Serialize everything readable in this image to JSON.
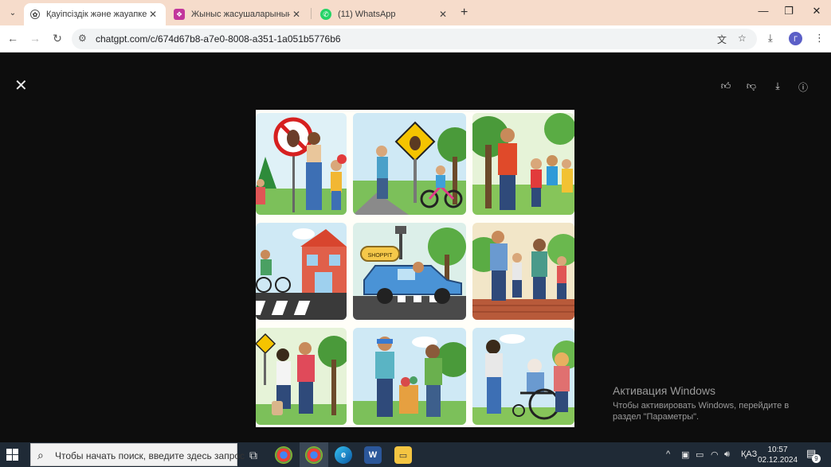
{
  "browser": {
    "tabs": [
      {
        "title": "Қауіпсіздік және жауапкершіл...",
        "active": true,
        "favicon": "chatgpt-icon"
      },
      {
        "title": "Жыныс жасушаларының қалы...",
        "active": false,
        "favicon": "app-icon"
      },
      {
        "title": "(11) WhatsApp",
        "active": false,
        "favicon": "whatsapp-icon"
      }
    ],
    "url": "chatgpt.com/c/674d67b8-a7e0-8008-a351-1a051b5776b6",
    "profile_initial": "Г"
  },
  "viewer": {
    "image_description_panels": 9
  },
  "activation": {
    "title": "Активация Windows",
    "text": "Чтобы активировать Windows, перейдите в раздел \"Параметры\"."
  },
  "image_text": {
    "sign": "SHOPPIT"
  },
  "taskbar": {
    "search_placeholder": "Чтобы начать поиск, введите здесь запрос",
    "language": "ҚАЗ",
    "time": "10:57",
    "date": "02.12.2024",
    "notifications": "9"
  },
  "colors": {
    "tabstrip": "#f6dccb",
    "viewer_bg": "#0d0d0d",
    "taskbar": "#1f2a36",
    "whatsapp": "#25d366",
    "app_magenta": "#c2369c"
  }
}
